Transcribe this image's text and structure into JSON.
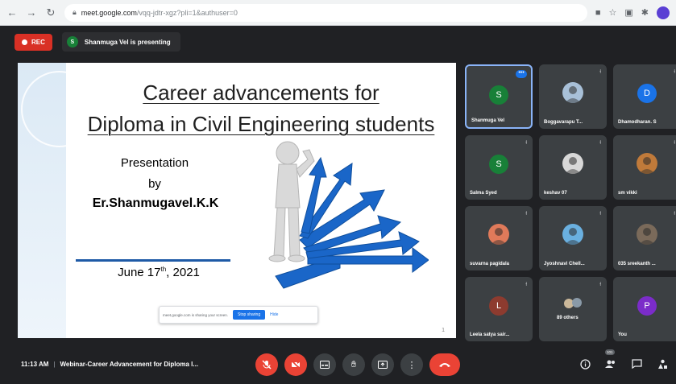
{
  "browser": {
    "url_host": "meet.google.com",
    "url_rest": "/vqq-jdtr-xgz?pli=1&authuser=0"
  },
  "meet": {
    "recording_label": "REC",
    "presenting_initial": "S",
    "presenting_text": "Shanmuga Vel is presenting"
  },
  "slide": {
    "title_line1": "Career advancements for",
    "title_line2": "Diploma in Civil Engineering students",
    "presentation_line1": "Presentation",
    "presentation_line2": "by",
    "presenter": "Er.Shanmugavel.K.K",
    "date_pre": "June 17",
    "date_sup": "th",
    "date_post": ", 2021",
    "share_text": "meet.google.com is sharing your screen.",
    "stop_label": "Stop sharing",
    "hide_label": "Hide",
    "page_number": "1"
  },
  "participants": [
    {
      "name": "Shanmuga Vel",
      "initial": "S",
      "color": "#188038",
      "type": "letter",
      "active": true,
      "menu": "•••"
    },
    {
      "name": "Boggavarapu T...",
      "type": "photo",
      "color": "#a8c0d8",
      "muted": true
    },
    {
      "name": "Dhamodharan. S",
      "initial": "D",
      "color": "#1a73e8",
      "type": "letter",
      "muted": true
    },
    {
      "name": "Salma Syed",
      "initial": "S",
      "color": "#188038",
      "type": "letter",
      "muted": true
    },
    {
      "name": "keshav 07",
      "type": "photo",
      "color": "#d8d8d8",
      "muted": true
    },
    {
      "name": "sm vikki",
      "type": "photo",
      "color": "#c07a3a",
      "muted": true
    },
    {
      "name": "suvarna pagidala",
      "type": "photo",
      "color": "#e07a5a",
      "muted": true
    },
    {
      "name": "Jyoshnavi Chell...",
      "type": "photo",
      "color": "#6ab0e0",
      "muted": true
    },
    {
      "name": "035 sreekanth ...",
      "type": "photo",
      "color": "#7a6a5a",
      "muted": true
    },
    {
      "name": "Leela satya sair...",
      "initial": "L",
      "color": "#8d3b2f",
      "type": "letter",
      "muted": true
    },
    {
      "name": "89 others",
      "type": "others",
      "color": "#9aa0a6",
      "muted": true
    },
    {
      "name": "You",
      "initial": "P",
      "color": "#7b2cc9",
      "type": "letter",
      "muted": false
    }
  ],
  "bottom": {
    "time": "11:13 AM",
    "meeting_title": "Webinar-Career Advancement for Diploma l...",
    "people_count": "101"
  },
  "icons": {
    "mic_off": "mic-off-icon",
    "cam_off": "camera-off-icon",
    "captions": "captions-icon",
    "hand": "raise-hand-icon",
    "present": "present-icon",
    "more": "more-options-icon",
    "end": "end-call-icon",
    "info": "info-icon",
    "people": "people-icon",
    "chat": "chat-icon",
    "activities": "activities-icon"
  },
  "colors": {
    "meet_bg": "#202124",
    "tile_bg": "#3c4043",
    "accent_red": "#ea4335",
    "rec_red": "#d93025",
    "accent_blue": "#1a73e8",
    "slide_blue": "#1e5aa6"
  }
}
